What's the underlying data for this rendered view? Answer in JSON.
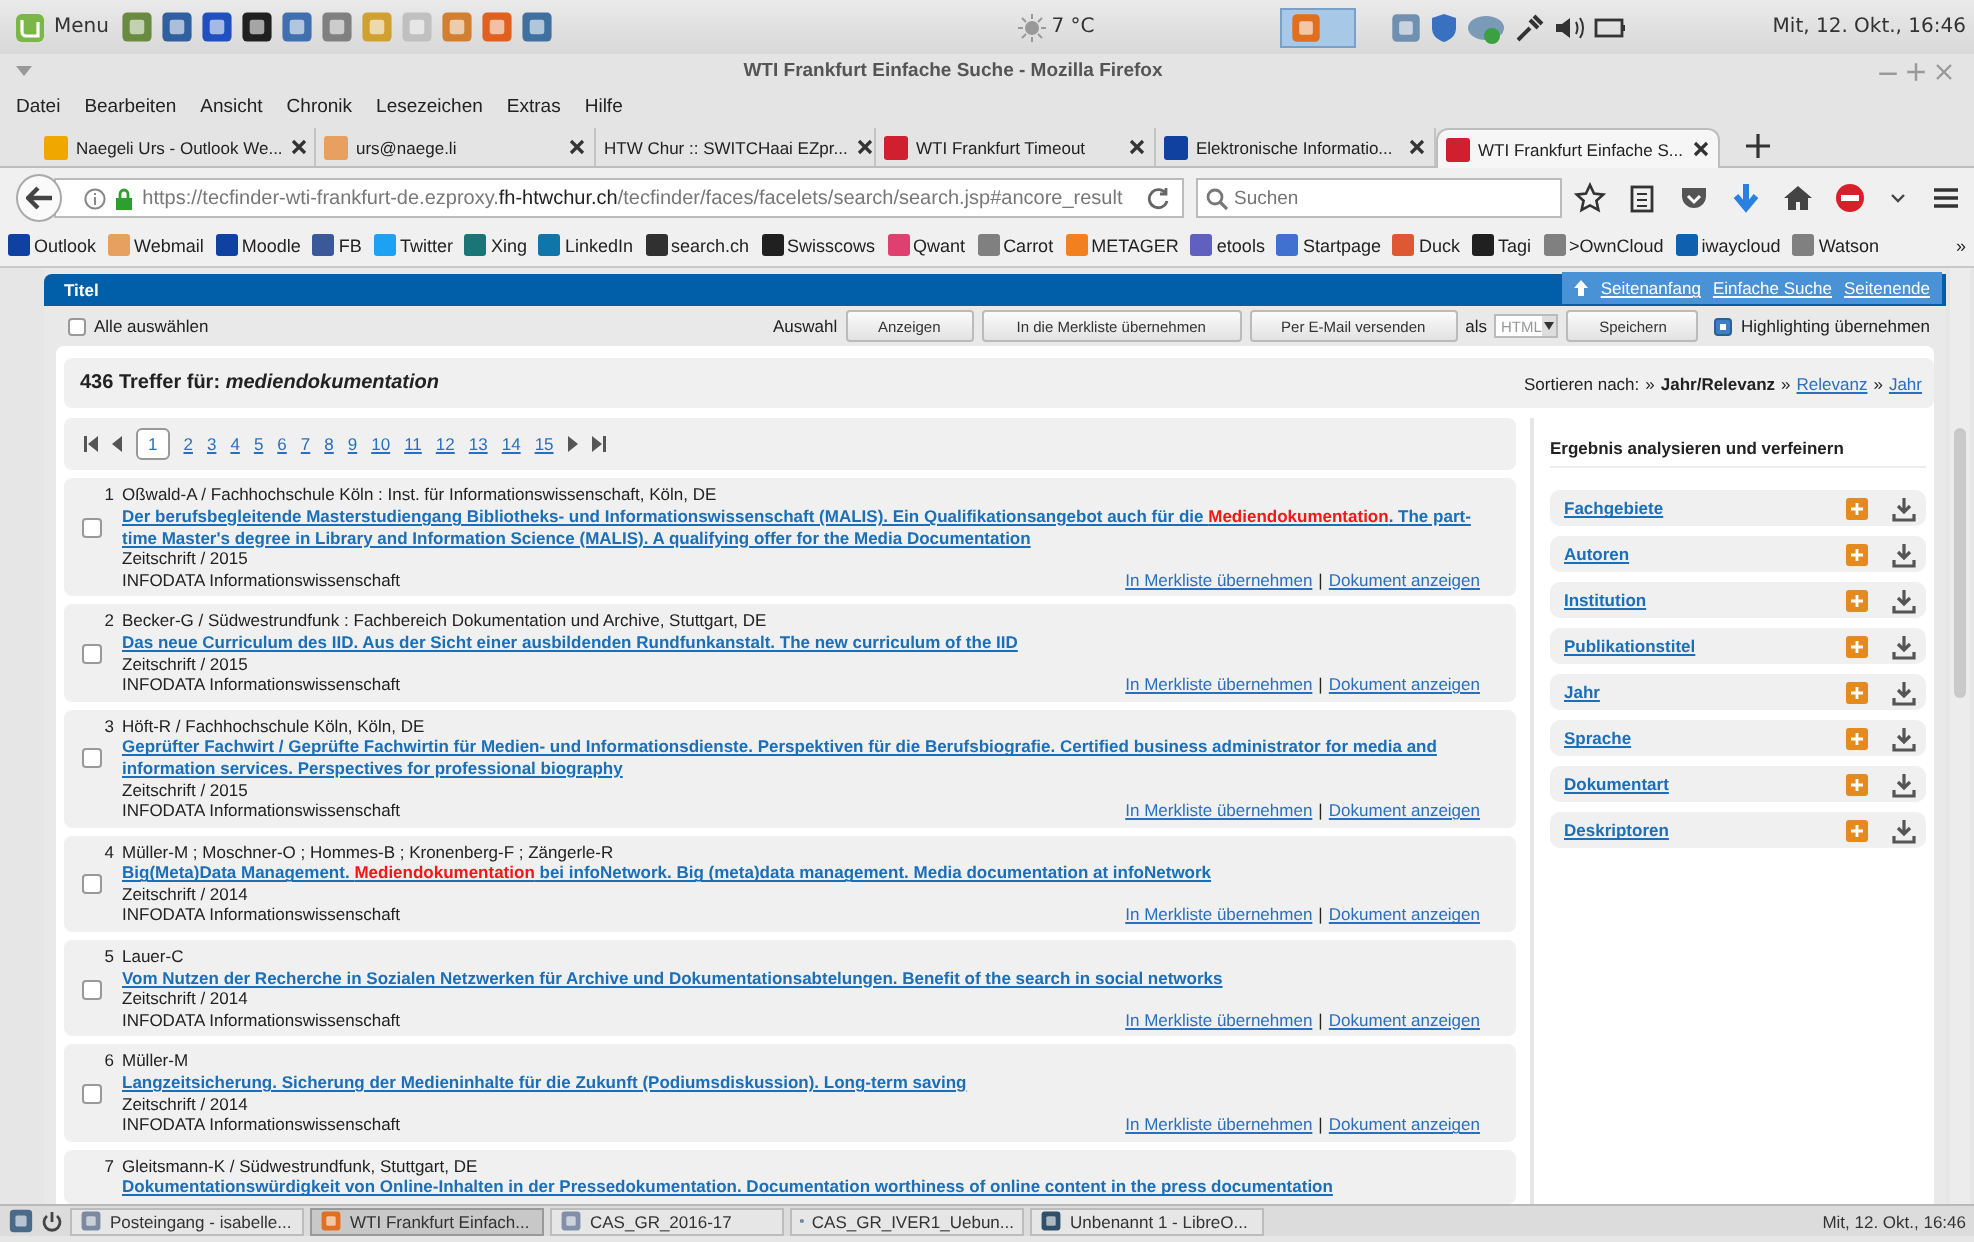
{
  "top_panel": {
    "menu_label": "Menu",
    "weather": "7 °C",
    "clock": "Mit, 12. Okt., 16:46"
  },
  "window": {
    "title": "WTI Frankfurt Einfache Suche - Mozilla Firefox"
  },
  "menu_bar": [
    "Datei",
    "Bearbeiten",
    "Ansicht",
    "Chronik",
    "Lesezeichen",
    "Extras",
    "Hilfe"
  ],
  "tabs": [
    {
      "label": "Naegeli Urs - Outlook We...",
      "selected": false,
      "color": "#f0a800"
    },
    {
      "label": "urs@naege.li",
      "selected": false,
      "color": "#e8a060"
    },
    {
      "label": "HTW Chur :: SWITCHaai EZpr...",
      "selected": false
    },
    {
      "label": "WTI Frankfurt Timeout",
      "selected": false,
      "color": "#d02030"
    },
    {
      "label": "Elektronische Informatio...",
      "selected": false,
      "color": "#1040a0"
    },
    {
      "label": "WTI Frankfurt Einfache S...",
      "selected": true,
      "color": "#d02030"
    }
  ],
  "address_bar": {
    "url": "https://tecfinder-wti-frankfurt-de.ezproxy.**fh-htwchur.ch**/tecfinder/faces/facelets/search/search.jsp#ancore_result"
  },
  "search_field": {
    "placeholder": "Suchen"
  },
  "bookmarks": [
    {
      "label": "Outlook",
      "color": "#1040a0"
    },
    {
      "label": "Webmail",
      "color": "#e8a060"
    },
    {
      "label": "Moodle",
      "color": "#1040a0"
    },
    {
      "label": "FB",
      "color": "#3b5998"
    },
    {
      "label": "Twitter",
      "color": "#1da1f2"
    },
    {
      "label": "Xing",
      "color": "#1a7576"
    },
    {
      "label": "LinkedIn",
      "color": "#0e76a8"
    },
    {
      "label": "search.ch",
      "color": "#303030"
    },
    {
      "label": "Swisscows",
      "color": "#202020"
    },
    {
      "label": "Qwant",
      "color": "#e04070"
    },
    {
      "label": "Carrot",
      "color": "#808080"
    },
    {
      "label": "METAGER",
      "color": "#f08020"
    },
    {
      "label": "etools",
      "color": "#6060c0"
    },
    {
      "label": "Startpage",
      "color": "#4070d0"
    },
    {
      "label": "Duck",
      "color": "#de5833"
    },
    {
      "label": "Tagi",
      "color": "#202020"
    },
    {
      "label": ">OwnCloud",
      "color": "#808080"
    },
    {
      "label": "iwaycloud",
      "color": "#1060b0"
    },
    {
      "label": "Watson",
      "color": "#808080"
    }
  ],
  "bookmarks_more": "»",
  "page": {
    "header_title": "Titel",
    "nav_links": [
      "Seitenanfang",
      "Einfache Suche",
      "Seitenende"
    ],
    "select_all": {
      "label": "Alle auswählen",
      "checked": false
    },
    "selection_label": "Auswahl",
    "actions": [
      "Anzeigen",
      "In die Merkliste übernehmen",
      "Per E-Mail versenden"
    ],
    "format_label": "als",
    "format_value": "HTML",
    "save_button": "Speichern",
    "highlighting": {
      "label": "Highlighting übernehmen",
      "checked": true
    },
    "hits": "436 Treffer für: *mediendokumentation*",
    "sort": {
      "label": "Sortieren nach:",
      "separator": "»",
      "options": [
        {
          "label": "Jahr/Relevanz",
          "selected": true
        },
        {
          "label": "Relevanz",
          "selected": false
        },
        {
          "label": "Jahr",
          "selected": false
        }
      ]
    },
    "pagination": [
      {
        "label": "1",
        "selected": true
      },
      {
        "label": "2",
        "selected": false
      },
      {
        "label": "3",
        "selected": false
      },
      {
        "label": "4",
        "selected": false
      },
      {
        "label": "5",
        "selected": false
      },
      {
        "label": "6",
        "selected": false
      },
      {
        "label": "7",
        "selected": false
      },
      {
        "label": "8",
        "selected": false
      },
      {
        "label": "9",
        "selected": false
      },
      {
        "label": "10",
        "selected": false
      },
      {
        "label": "11",
        "selected": false
      },
      {
        "label": "12",
        "selected": false
      },
      {
        "label": "13",
        "selected": false
      },
      {
        "label": "14",
        "selected": false
      },
      {
        "label": "15",
        "selected": false
      }
    ],
    "results": [
      {
        "number": "1",
        "authors": "Oßwald-A / Fachhochschule Köln : Inst. für Informationswissenschaft, Köln, DE",
        "checked": false,
        "title_parts": [
          {
            "text": "Der berufsbegleitende Masterstudiengang Bibliotheks- und Informationswissenschaft (MALIS). Ein Qualifikationsangebot auch für die ",
            "highlight": false
          },
          {
            "text": "Mediendokumentation",
            "highlight": true
          },
          {
            "text": ". The part-time Master's degree in Library and Information Science (MALIS). A qualifying offer for the Media Documentation",
            "highlight": false
          }
        ],
        "type_year": "Zeitschrift / 2015",
        "source": "INFODATA Informationswissenschaft",
        "links": [
          "In Merkliste übernehmen",
          "Dokument anzeigen"
        ],
        "separator": "|"
      },
      {
        "number": "2",
        "authors": "Becker-G / Südwestrundfunk : Fachbereich Dokumentation und Archive, Stuttgart, DE",
        "checked": false,
        "title_parts": [
          {
            "text": "Das neue Curriculum des IID. Aus der Sicht einer ausbildenden Rundfunkanstalt. The new curriculum of the IID",
            "highlight": false
          }
        ],
        "type_year": "Zeitschrift / 2015",
        "source": "INFODATA Informationswissenschaft",
        "links": [
          "In Merkliste übernehmen",
          "Dokument anzeigen"
        ],
        "separator": "|"
      },
      {
        "number": "3",
        "authors": "Höft-R / Fachhochschule Köln, Köln, DE",
        "checked": false,
        "title_parts": [
          {
            "text": "Geprüfter Fachwirt / Geprüfte Fachwirtin für Medien- und Informationsdienste. Perspektiven für die Berufsbiografie. Certified business administrator for media and information services. Perspectives for professional biography",
            "highlight": false
          }
        ],
        "type_year": "Zeitschrift / 2015",
        "source": "INFODATA Informationswissenschaft",
        "links": [
          "In Merkliste übernehmen",
          "Dokument anzeigen"
        ],
        "separator": "|"
      },
      {
        "number": "4",
        "authors": "Müller-M ; Moschner-O ; Hommes-B ; Kronenberg-F ; Zängerle-R",
        "checked": false,
        "title_parts": [
          {
            "text": "Big(Meta)Data Management. ",
            "highlight": false
          },
          {
            "text": "Mediendokumentation",
            "highlight": true
          },
          {
            "text": " bei infoNetwork. Big (meta)data management. Media documentation at infoNetwork",
            "highlight": false
          }
        ],
        "type_year": "Zeitschrift / 2014",
        "source": "INFODATA Informationswissenschaft",
        "links": [
          "In Merkliste übernehmen",
          "Dokument anzeigen"
        ],
        "separator": "|"
      },
      {
        "number": "5",
        "authors": "Lauer-C",
        "checked": false,
        "title_parts": [
          {
            "text": "Vom Nutzen der Recherche in Sozialen Netzwerken für Archive und Dokumentationsabtelungen. Benefit of the search in social networks",
            "highlight": false
          }
        ],
        "type_year": "Zeitschrift / 2014",
        "source": "INFODATA Informationswissenschaft",
        "links": [
          "In Merkliste übernehmen",
          "Dokument anzeigen"
        ],
        "separator": "|"
      },
      {
        "number": "6",
        "authors": "Müller-M",
        "checked": false,
        "title_parts": [
          {
            "text": "Langzeitsicherung. Sicherung der Medieninhalte für die Zukunft (Podiumsdiskussion). Long-term saving",
            "highlight": false
          }
        ],
        "type_year": "Zeitschrift / 2014",
        "source": "INFODATA Informationswissenschaft",
        "links": [
          "In Merkliste übernehmen",
          "Dokument anzeigen"
        ],
        "separator": "|"
      },
      {
        "number": "7",
        "authors": "Gleitsmann-K / Südwestrundfunk, Stuttgart, DE",
        "title_parts": [
          {
            "text": "Dokumentationswürdigkeit von Online-Inhalten in der Pressedokumentation. Documentation worthiness of online content in the press documentation",
            "highlight": false
          }
        ]
      }
    ],
    "refine": {
      "title": "Ergebnis analysieren und verfeinern",
      "facets": [
        "Fachgebiete",
        "Autoren",
        "Institution",
        "Publikationstitel",
        "Jahr",
        "Sprache",
        "Dokumentart",
        "Deskriptoren"
      ]
    }
  },
  "taskbar": {
    "tasks": [
      {
        "label": "Posteingang - isabelle...",
        "selected": false
      },
      {
        "label": "WTI Frankfurt Einfach...",
        "selected": true
      },
      {
        "label": "CAS_GR_2016-17",
        "selected": false
      },
      {
        "label": "CAS_GR_IVER1_Uebun...",
        "selected": false
      },
      {
        "label": "Unbenannt 1 - LibreO...",
        "selected": false
      }
    ],
    "clock": "Mit, 12. Okt., 16:46"
  }
}
